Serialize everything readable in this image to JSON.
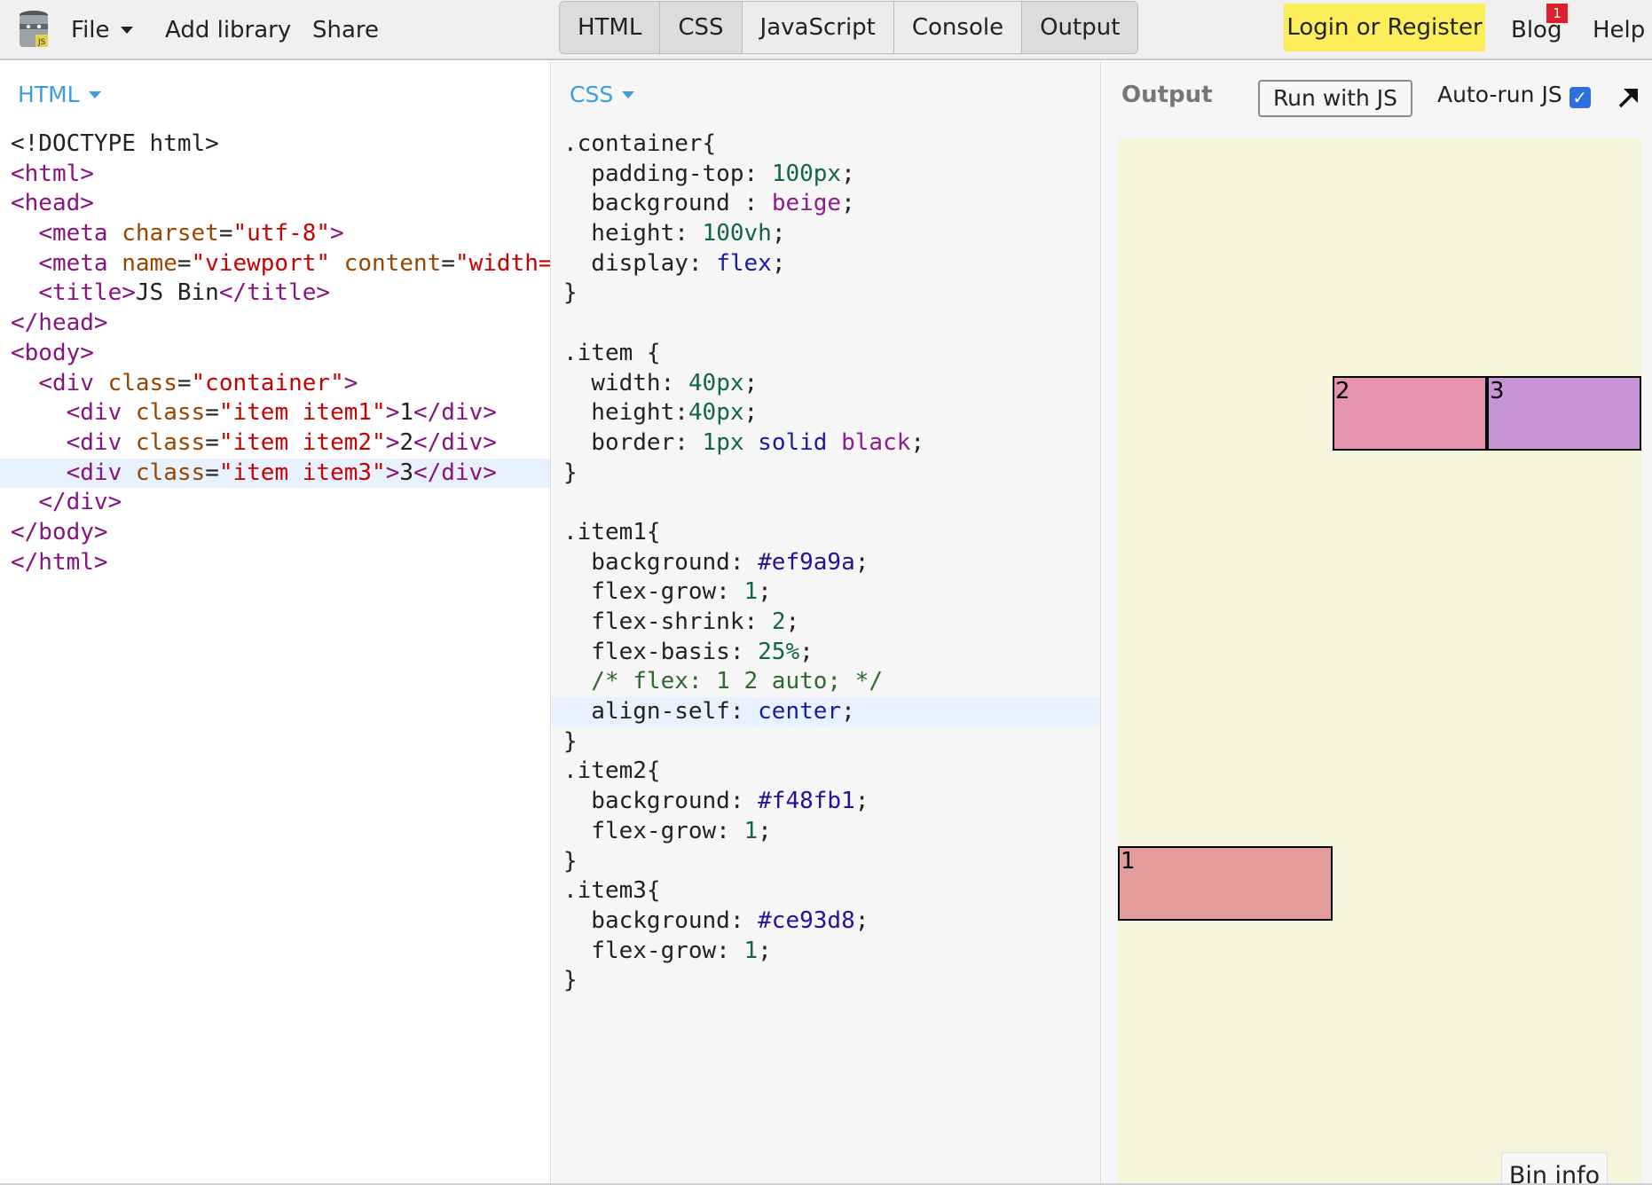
{
  "topbar": {
    "menu": {
      "file": "File",
      "add_library": "Add library",
      "share": "Share"
    },
    "tabs": [
      "HTML",
      "CSS",
      "JavaScript",
      "Console",
      "Output"
    ],
    "login": "Login or Register",
    "blog": "Blog",
    "blog_badge": "1",
    "help": "Help",
    "login_color": "#fcee5a"
  },
  "html_pane": {
    "label": "HTML",
    "active_line": 11
  },
  "css_pane": {
    "label": "CSS",
    "active_line": 19
  },
  "output_pane": {
    "label": "Output",
    "run_button": "Run with JS",
    "autorun_label": "Auto-run JS",
    "autorun_checked": true,
    "preview": {
      "background": "#f5f5dc",
      "items": [
        {
          "label": "1",
          "color": "#e49c9a"
        },
        {
          "label": "2",
          "color": "#e693ad"
        },
        {
          "label": "3",
          "color": "#c795d6"
        }
      ]
    },
    "bin_info": "Bin info"
  },
  "html_code": [
    [
      [
        "tok-text",
        "<!DOCTYPE html>"
      ]
    ],
    [
      [
        "tok-tag",
        "<html>"
      ]
    ],
    [
      [
        "tok-tag",
        "<head>"
      ]
    ],
    [
      [
        "tok-text",
        "  "
      ],
      [
        "tok-tag",
        "<meta "
      ],
      [
        "tok-attr",
        "charset"
      ],
      [
        "tok-text",
        "="
      ],
      [
        "tok-str",
        "\"utf-8\""
      ],
      [
        "tok-tag",
        ">"
      ]
    ],
    [
      [
        "tok-text",
        "  "
      ],
      [
        "tok-tag",
        "<meta "
      ],
      [
        "tok-attr",
        "name"
      ],
      [
        "tok-text",
        "="
      ],
      [
        "tok-str",
        "\"viewport\""
      ],
      [
        "tok-text",
        " "
      ],
      [
        "tok-attr",
        "content"
      ],
      [
        "tok-text",
        "="
      ],
      [
        "tok-str",
        "\"width=device-width\""
      ],
      [
        "tok-tag",
        ">"
      ]
    ],
    [
      [
        "tok-text",
        "  "
      ],
      [
        "tok-tag",
        "<title>"
      ],
      [
        "tok-text",
        "JS Bin"
      ],
      [
        "tok-tag",
        "</title>"
      ]
    ],
    [
      [
        "tok-tag",
        "</head>"
      ]
    ],
    [
      [
        "tok-tag",
        "<body>"
      ]
    ],
    [
      [
        "tok-text",
        "  "
      ],
      [
        "tok-tag",
        "<div "
      ],
      [
        "tok-attr",
        "class"
      ],
      [
        "tok-text",
        "="
      ],
      [
        "tok-str",
        "\"container\""
      ],
      [
        "tok-tag",
        ">"
      ]
    ],
    [
      [
        "tok-text",
        "    "
      ],
      [
        "tok-tag",
        "<div "
      ],
      [
        "tok-attr",
        "class"
      ],
      [
        "tok-text",
        "="
      ],
      [
        "tok-str",
        "\"item item1\""
      ],
      [
        "tok-tag",
        ">"
      ],
      [
        "tok-text",
        "1"
      ],
      [
        "tok-tag",
        "</div>"
      ]
    ],
    [
      [
        "tok-text",
        "    "
      ],
      [
        "tok-tag",
        "<div "
      ],
      [
        "tok-attr",
        "class"
      ],
      [
        "tok-text",
        "="
      ],
      [
        "tok-str",
        "\"item item2\""
      ],
      [
        "tok-tag",
        ">"
      ],
      [
        "tok-text",
        "2"
      ],
      [
        "tok-tag",
        "</div>"
      ]
    ],
    [
      [
        "tok-text",
        "    "
      ],
      [
        "tok-tag",
        "<div "
      ],
      [
        "tok-attr",
        "class"
      ],
      [
        "tok-text",
        "="
      ],
      [
        "tok-str",
        "\"item item3\""
      ],
      [
        "tok-tag",
        ">"
      ],
      [
        "tok-text",
        "3"
      ],
      [
        "tok-tag",
        "</div>"
      ]
    ],
    [
      [
        "tok-text",
        "  "
      ],
      [
        "tok-tag",
        "</div>"
      ]
    ],
    [
      [
        "tok-tag",
        "</body>"
      ]
    ],
    [
      [
        "tok-tag",
        "</html>"
      ]
    ]
  ],
  "css_code": [
    [
      [
        "tok-sel",
        ".container{"
      ]
    ],
    [
      [
        "tok-prop",
        "  padding-top: "
      ],
      [
        "tok-num",
        "100px"
      ],
      [
        "tok-text",
        ";"
      ]
    ],
    [
      [
        "tok-prop",
        "  background : "
      ],
      [
        "tok-val",
        "beige"
      ],
      [
        "tok-text",
        ";"
      ]
    ],
    [
      [
        "tok-prop",
        "  height: "
      ],
      [
        "tok-num",
        "100vh"
      ],
      [
        "tok-text",
        ";"
      ]
    ],
    [
      [
        "tok-prop",
        "  display: "
      ],
      [
        "tok-kw",
        "flex"
      ],
      [
        "tok-text",
        ";"
      ]
    ],
    [
      [
        "tok-text",
        "}"
      ]
    ],
    [
      [
        "tok-text",
        ""
      ]
    ],
    [
      [
        "tok-sel",
        ".item {"
      ]
    ],
    [
      [
        "tok-prop",
        "  width: "
      ],
      [
        "tok-num",
        "40px"
      ],
      [
        "tok-text",
        ";"
      ]
    ],
    [
      [
        "tok-prop",
        "  height:"
      ],
      [
        "tok-num",
        "40px"
      ],
      [
        "tok-text",
        ";"
      ]
    ],
    [
      [
        "tok-prop",
        "  border: "
      ],
      [
        "tok-num",
        "1px"
      ],
      [
        "tok-text",
        " "
      ],
      [
        "tok-kw",
        "solid"
      ],
      [
        "tok-text",
        " "
      ],
      [
        "tok-val",
        "black"
      ],
      [
        "tok-text",
        ";"
      ]
    ],
    [
      [
        "tok-text",
        "}"
      ]
    ],
    [
      [
        "tok-text",
        ""
      ]
    ],
    [
      [
        "tok-sel",
        ".item1{"
      ]
    ],
    [
      [
        "tok-prop",
        "  background: "
      ],
      [
        "tok-atom",
        "#ef9a9a"
      ],
      [
        "tok-text",
        ";"
      ]
    ],
    [
      [
        "tok-prop",
        "  flex-grow: "
      ],
      [
        "tok-num",
        "1"
      ],
      [
        "tok-text",
        ";"
      ]
    ],
    [
      [
        "tok-prop",
        "  flex-shrink: "
      ],
      [
        "tok-num",
        "2"
      ],
      [
        "tok-text",
        ";"
      ]
    ],
    [
      [
        "tok-prop",
        "  flex-basis: "
      ],
      [
        "tok-num",
        "25%"
      ],
      [
        "tok-text",
        ";"
      ]
    ],
    [
      [
        "tok-com",
        "  /* flex: 1 2 auto; */"
      ]
    ],
    [
      [
        "tok-prop",
        "  align-self: "
      ],
      [
        "tok-kw",
        "center"
      ],
      [
        "tok-text",
        ";"
      ]
    ],
    [
      [
        "tok-text",
        "}"
      ]
    ],
    [
      [
        "tok-sel",
        ".item2{"
      ]
    ],
    [
      [
        "tok-prop",
        "  background: "
      ],
      [
        "tok-atom",
        "#f48fb1"
      ],
      [
        "tok-text",
        ";"
      ]
    ],
    [
      [
        "tok-prop",
        "  flex-grow: "
      ],
      [
        "tok-num",
        "1"
      ],
      [
        "tok-text",
        ";"
      ]
    ],
    [
      [
        "tok-text",
        "}"
      ]
    ],
    [
      [
        "tok-sel",
        ".item3{"
      ]
    ],
    [
      [
        "tok-prop",
        "  background: "
      ],
      [
        "tok-atom",
        "#ce93d8"
      ],
      [
        "tok-text",
        ";"
      ]
    ],
    [
      [
        "tok-prop",
        "  flex-grow: "
      ],
      [
        "tok-num",
        "1"
      ],
      [
        "tok-text",
        ";"
      ]
    ],
    [
      [
        "tok-text",
        "}"
      ]
    ]
  ]
}
